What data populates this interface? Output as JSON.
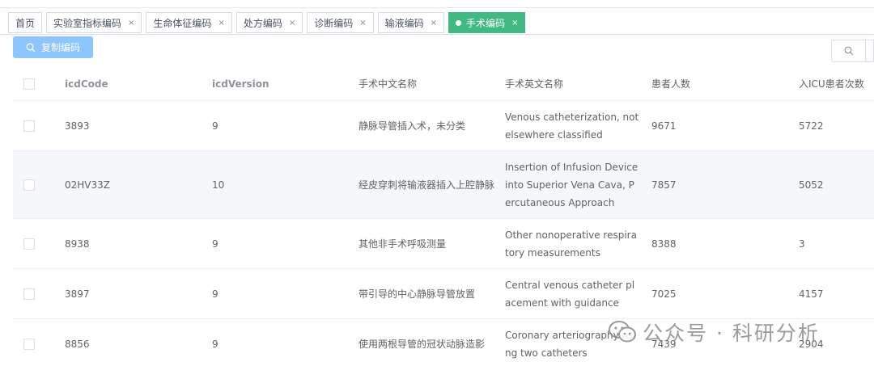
{
  "tabs": [
    {
      "label": "首页",
      "closable": false,
      "active": false
    },
    {
      "label": "实验室指标编码",
      "closable": true,
      "active": false
    },
    {
      "label": "生命体征编码",
      "closable": true,
      "active": false
    },
    {
      "label": "处方编码",
      "closable": true,
      "active": false
    },
    {
      "label": "诊断编码",
      "closable": true,
      "active": false
    },
    {
      "label": "输液编码",
      "closable": true,
      "active": false
    },
    {
      "label": "手术编码",
      "closable": true,
      "active": true
    }
  ],
  "tab_close_glyph": "×",
  "toolbar": {
    "copy_label": "复制编码"
  },
  "table": {
    "columns": [
      "icdCode",
      "icdVersion",
      "手术中文名称",
      "手术英文名称",
      "患者人数",
      "入ICU患者次数"
    ],
    "rows": [
      {
        "icdCode": "3893",
        "icdVersion": "9",
        "name_cn": "静脉导管插入术，未分类",
        "name_en": "Venous catheterization, not elsewhere classified",
        "patients": "9671",
        "icu_visits": "5722"
      },
      {
        "icdCode": "02HV33Z",
        "icdVersion": "10",
        "name_cn": "经皮穿刺将输液器插入上腔静脉",
        "name_en": "Insertion of Infusion Device into Superior Vena Cava, Percutaneous Approach",
        "patients": "7857",
        "icu_visits": "5052"
      },
      {
        "icdCode": "8938",
        "icdVersion": "9",
        "name_cn": "其他非手术呼吸测量",
        "name_en": "Other nonoperative respiratory measurements",
        "patients": "8388",
        "icu_visits": "3"
      },
      {
        "icdCode": "3897",
        "icdVersion": "9",
        "name_cn": "带引导的中心静脉导管放置",
        "name_en": "Central venous catheter placement with guidance",
        "patients": "7025",
        "icu_visits": "4157"
      },
      {
        "icdCode": "8856",
        "icdVersion": "9",
        "name_cn": "使用两根导管的冠状动脉造影",
        "name_en": "Coronary arteriography using two catheters",
        "patients": "7439",
        "icu_visits": "2904"
      }
    ]
  },
  "watermark": {
    "text": "公众号 · 科研分析"
  },
  "colors": {
    "active_tab": "#42b983",
    "primary_button": "#8cc5ff",
    "stripe": "#f5f7fa"
  }
}
